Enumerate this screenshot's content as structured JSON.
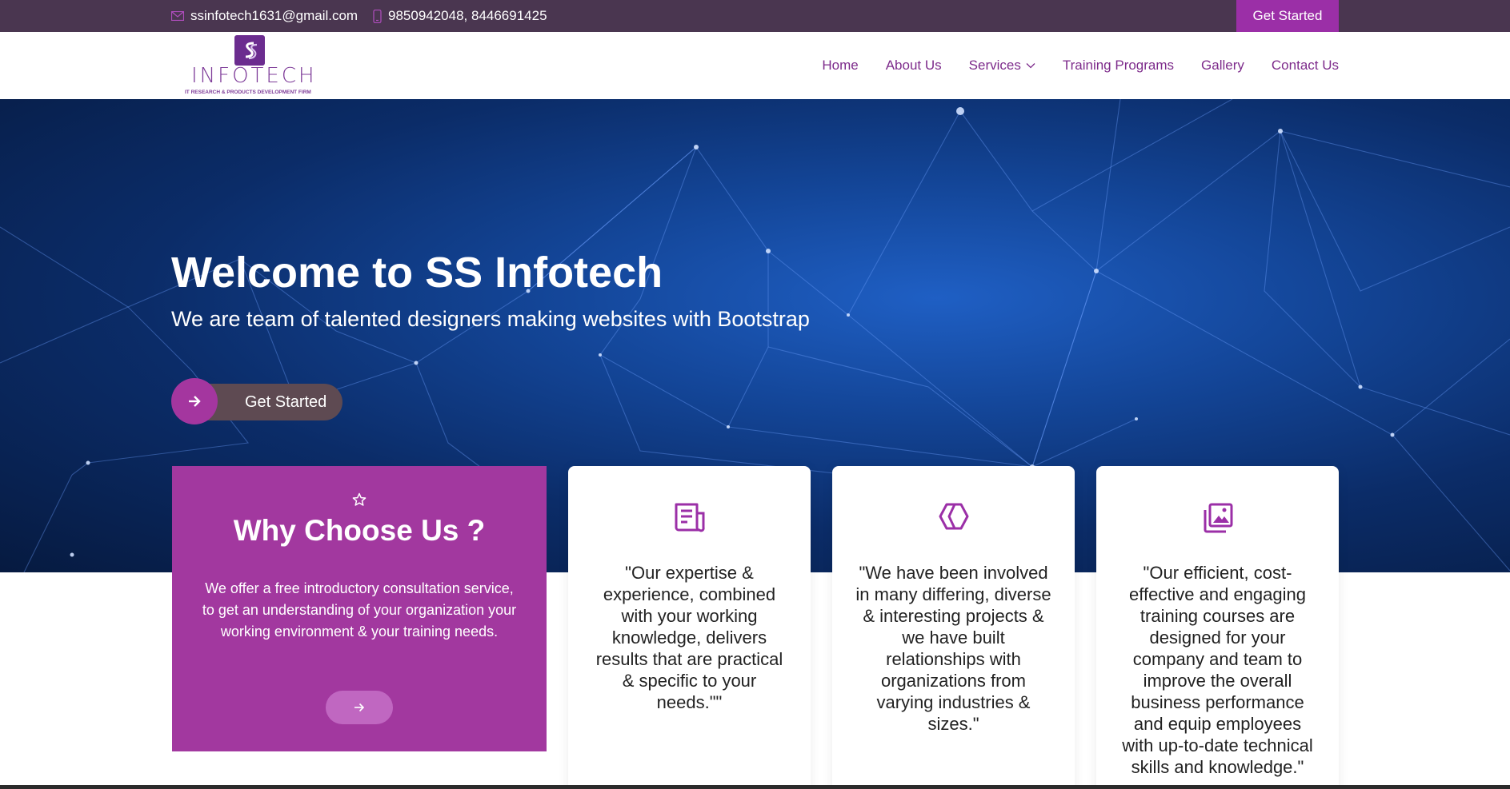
{
  "topbar": {
    "email": "ssinfotech1631@gmail.com",
    "phone": "9850942048, 8446691425",
    "cta_label": "Get Started"
  },
  "header": {
    "logo": {
      "wordmark": "INFOTECH",
      "tagline": "IT RESEARCH & PRODUCTS DEVELOPMENT FIRM"
    },
    "nav": [
      {
        "label": "Home"
      },
      {
        "label": "About Us"
      },
      {
        "label": "Services",
        "has_dropdown": true
      },
      {
        "label": "Training Programs"
      },
      {
        "label": "Gallery"
      },
      {
        "label": "Contact Us"
      }
    ]
  },
  "hero": {
    "title": "Welcome to SS Infotech",
    "subtitle": "We are team of talented designers making websites with Bootstrap",
    "button_label": "Get Started",
    "button_icon": "arrow-right-icon"
  },
  "why": {
    "icon": "star-icon",
    "title": "Why Choose Us ?",
    "text": "We offer a free introductory consultation service, to get an understanding of your organization your working environment & your training needs.",
    "button_icon": "arrow-right-icon"
  },
  "cards": [
    {
      "icon": "newspaper-icon",
      "text": "\"Our expertise & experience, combined with your working knowledge, delivers results that are practical & specific to your needs.\"\""
    },
    {
      "icon": "hexagon-icon",
      "text": "\"We have been involved in many differing, diverse & interesting projects & we have built relationships with organizations from varying industries & sizes.\""
    },
    {
      "icon": "images-icon",
      "text": "\"Our efficient, cost-effective and engaging training courses are designed for your company and team to improve the overall business performance and equip employees with up-to-date technical skills and knowledge.\""
    }
  ],
  "colors": {
    "topbar_bg": "#4a3650",
    "accent": "#a2389f",
    "nav_text": "#7d2b8b",
    "hero_bg": "#0b2c68"
  }
}
